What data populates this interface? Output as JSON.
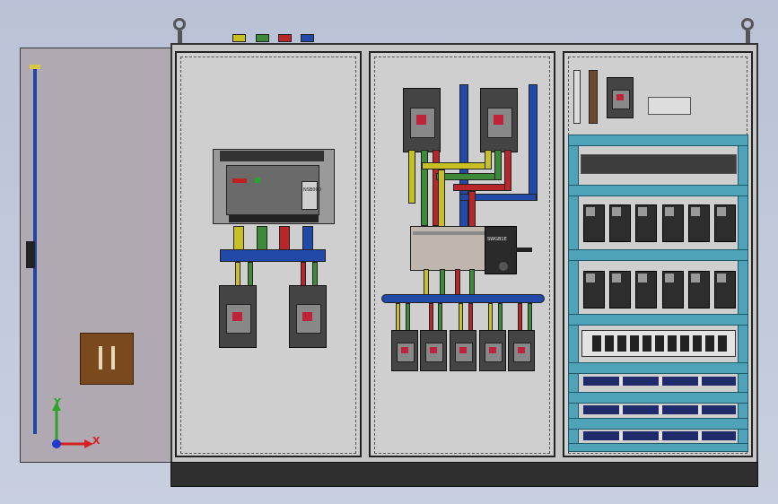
{
  "acb": {
    "brand_label": "NSB000"
  },
  "transformer": {
    "label": "SWGB1E"
  },
  "axes": {
    "x_label": "X",
    "y_label": "Y"
  },
  "colors": {
    "yellow": "#c8c020",
    "green": "#3d8a3a",
    "red": "#b8262a",
    "blue": "#2149a8",
    "rail": "#4ea3b9"
  }
}
